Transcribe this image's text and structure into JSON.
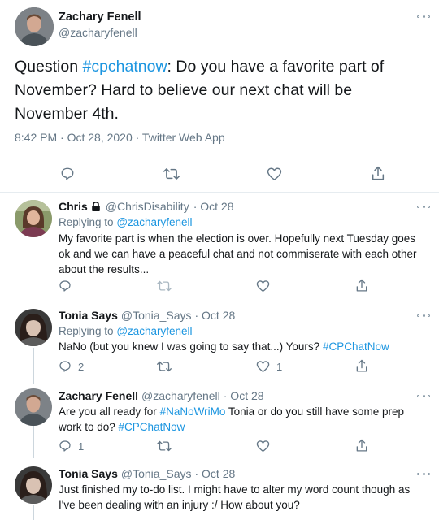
{
  "main_tweet": {
    "name": "Zachary Fenell",
    "handle": "@zacharyfenell",
    "text_before": "Question ",
    "hashtag": "#cpchatnow",
    "text_after": ": Do you have a favorite part of November? Hard to believe our next chat will be November 4th.",
    "meta": "8:42 PM · Oct 28, 2020 · Twitter Web App"
  },
  "replies": [
    {
      "name": "Chris",
      "handle": "@ChrisDisability",
      "date": "· Oct 28",
      "replying_label": "Replying to",
      "replying_to": "@zacharyfenell",
      "text": "My favorite part is when the election is over. Hopefully next Tuesday goes ok and we can have a peaceful chat and not commiserate with each other about the results...",
      "reply_count": "",
      "like_count": ""
    },
    {
      "name": "Tonia Says",
      "handle": "@Tonia_Says",
      "date": "· Oct 28",
      "replying_label": "Replying to",
      "replying_to": "@zacharyfenell",
      "text": "NaNo (but you knew I was going to say that...) Yours? ",
      "hashtag": "#CPChatNow",
      "reply_count": "2",
      "like_count": "1"
    },
    {
      "name": "Zachary Fenell",
      "handle": "@zacharyfenell",
      "date": "· Oct 28",
      "text_before": "Are you all ready for ",
      "hashtag1": "#NaNoWriMo",
      "text_middle": " Tonia or do you still have some prep work to do? ",
      "hashtag2": "#CPChatNow",
      "reply_count": "1",
      "like_count": ""
    },
    {
      "name": "Tonia Says",
      "handle": "@Tonia_Says",
      "date": "· Oct 28",
      "text": "Just finished my to-do list.  I might have to alter my word count though as I've been dealing with an injury :/ How about you?"
    }
  ],
  "colors": {
    "link": "#1b95e0",
    "muted": "#657786",
    "divider": "#e6ecf0"
  }
}
